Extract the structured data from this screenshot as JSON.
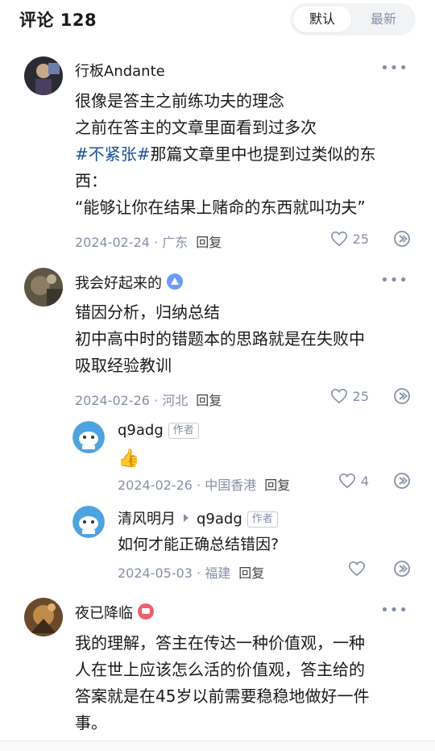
{
  "header": {
    "title": "评论 128",
    "sort_default": "默认",
    "sort_newest": "最新"
  },
  "comments": [
    {
      "author": "行板Andante",
      "lines": [
        "很像是答主之前练功夫的理念",
        "之前在答主的文章里面看到过多次"
      ],
      "hashtag": "#不紧张#",
      "line3_rest": "那篇文章里中也提到过类似的东",
      "line4": "西：",
      "line5": "“能够让你在结果上赌命的东西就叫功夫”",
      "meta": "2024-02-24 · 广东",
      "reply": "回复",
      "likes": "25"
    },
    {
      "author": "我会好起来的",
      "lines": [
        "错因分析，归纳总结",
        "初中高中时的错题本的思路就是在失败中",
        "吸取经验教训"
      ],
      "meta": "2024-02-26 · 河北",
      "reply": "回复",
      "likes": "25",
      "replies": [
        {
          "author": "q9adg",
          "tag": "作者",
          "emoji": "👍",
          "meta": "2024-02-26 · 中国香港",
          "reply": "回复",
          "likes": "4"
        },
        {
          "author": "清风明月",
          "reply_to": "q9adg",
          "tag": "作者",
          "text": "如何才能正确总结错因?",
          "meta": "2024-05-03 · 福建",
          "reply": "回复",
          "likes": ""
        }
      ]
    },
    {
      "author": "夜已降临",
      "lines": [
        "我的理解，答主在传达一种价值观，一种",
        "人在世上应该怎么活的价值观，答主给的",
        "答案就是在45岁以前需要稳稳地做好一件",
        "事。"
      ]
    }
  ],
  "icons": {
    "more": "more-dots-icon",
    "like": "heart-icon",
    "share": "share-icon"
  },
  "colors": {
    "hashtag": "#175199",
    "meta": "#8590a6"
  }
}
